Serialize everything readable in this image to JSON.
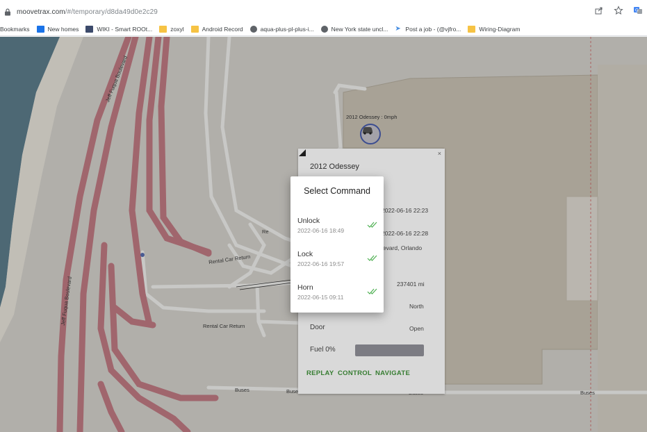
{
  "browser": {
    "url_host": "moovetrax.com",
    "url_path": "/#/temporary/d8da49d0e2c29",
    "bookmarks": [
      {
        "label": "Bookmarks",
        "icon": "none"
      },
      {
        "label": "New homes",
        "icon": "blue"
      },
      {
        "label": "WIKI - Smart ROOt...",
        "icon": "dark"
      },
      {
        "label": "zoxyl",
        "icon": "folder"
      },
      {
        "label": "Android Record",
        "icon": "folder"
      },
      {
        "label": "aqua-plus-pl-plus-i...",
        "icon": "globe"
      },
      {
        "label": "New York state uncl...",
        "icon": "globe"
      },
      {
        "label": "Post a job - (@vjfro...",
        "icon": "arrow"
      },
      {
        "label": "Wiring-Diagram",
        "icon": "folder"
      }
    ]
  },
  "map": {
    "labels": {
      "jeff_fuqua_1": "Jeff Fuqua Boulevard",
      "jeff_fuqua_2": "Jeff Fuqua Boulevard",
      "rental_car_return_1": "Rental Car Return",
      "rental_car_return_2": "Rental Car Return",
      "buses_1": "Buses",
      "buses_2": "Buses",
      "buses_3": "Buses",
      "buses_4": "Buses",
      "partial_res": "Re"
    },
    "marker_label": "2012 Odessey : 0mph"
  },
  "vehicle_popup": {
    "close": "×",
    "title": "2012 Odessey",
    "time_1": "2022-06-16 22:23",
    "time_2": "2022-06-16 22:28",
    "address": "levard, Orlando",
    "odometer": "237401 mi",
    "heading": "North",
    "door_label": "Door",
    "door_value": "Open",
    "fuel_label": "Fuel 0%",
    "fuel_level": 0,
    "actions": {
      "replay": "REPLAY",
      "control": "CONTROL",
      "navigate": "NAVIGATE"
    }
  },
  "dialog": {
    "title": "Select Command",
    "commands": [
      {
        "name": "Unlock",
        "time": "2022-06-16 18:49",
        "status": "delivered"
      },
      {
        "name": "Lock",
        "time": "2022-06-16 19:57",
        "status": "delivered"
      },
      {
        "name": "Horn",
        "time": "2022-06-15 09:11",
        "status": "delivered"
      }
    ]
  },
  "colors": {
    "road_main": "#c47d86",
    "road_minor": "#f4f4f2",
    "water": "#5e7f8e",
    "building": "#c7bfb0",
    "accent_green": "#3f8f3a",
    "check_green": "#4caf50"
  }
}
